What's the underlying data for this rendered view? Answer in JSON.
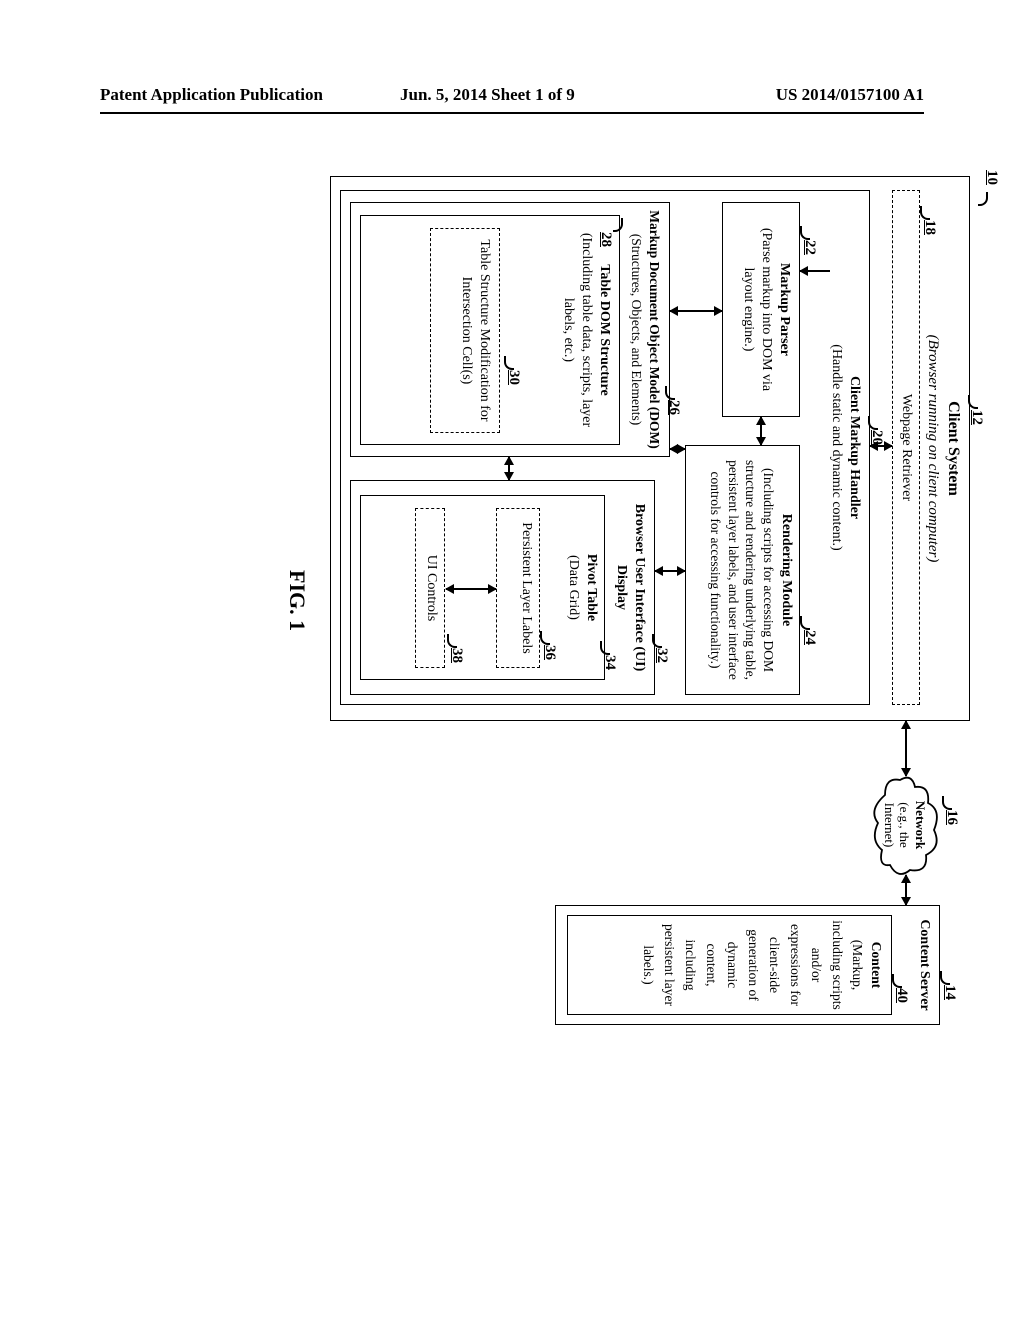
{
  "header": {
    "left": "Patent Application Publication",
    "middle": "Jun. 5, 2014   Sheet 1 of 9",
    "right": "US 2014/0157100 A1"
  },
  "figure": {
    "caption": "FIG. 1",
    "refs": {
      "r10": "10",
      "r12": "12",
      "r14": "14",
      "r16": "16",
      "r18": "18",
      "r20": "20",
      "r22": "22",
      "r24": "24",
      "r26": "26",
      "r28": "28",
      "r30": "30",
      "r32": "32",
      "r34": "34",
      "r36": "36",
      "r38": "38",
      "r40": "40"
    },
    "blocks": {
      "client_system_title": "Client System",
      "client_system_sub": "(Browser running on client computer)",
      "webpage_retriever": "Webpage Retriever",
      "client_markup_handler_title": "Client Markup Handler",
      "client_markup_handler_sub": "(Handle static and dynamic content.)",
      "markup_parser_title": "Markup Parser",
      "markup_parser_sub": "(Parse markup into DOM via layout engine.)",
      "rendering_module_title": "Rendering Module",
      "rendering_module_sub": "(Including scripts for accessing DOM structure and rendering underlying table, persistent layer labels, and user interface controls for accessing functionality.)",
      "dom_title": "Markup Document Object Model (DOM)",
      "dom_sub": "(Structures, Objects, and Elements)",
      "table_dom_title": "Table DOM Structure",
      "table_dom_sub": "(Including table data, scripts, layer labels, etc.)",
      "table_mod_title": "Table Structure Modification for Intersection Cell(s)",
      "browser_ui_title": "Browser User Interface (UI) Display",
      "pivot_title": "Pivot Table",
      "pivot_sub": "(Data Grid)",
      "persistent_layer": "Persistent Layer Labels",
      "ui_controls": "UI Controls",
      "network_title": "Network",
      "network_sub": "(e.g., the Internet)",
      "content_server": "Content Server",
      "content_title": "Content",
      "content_body": "(Markup, including scripts and/or expressions for client-side generation of dynamic content, including persistent layer labels.)"
    }
  }
}
